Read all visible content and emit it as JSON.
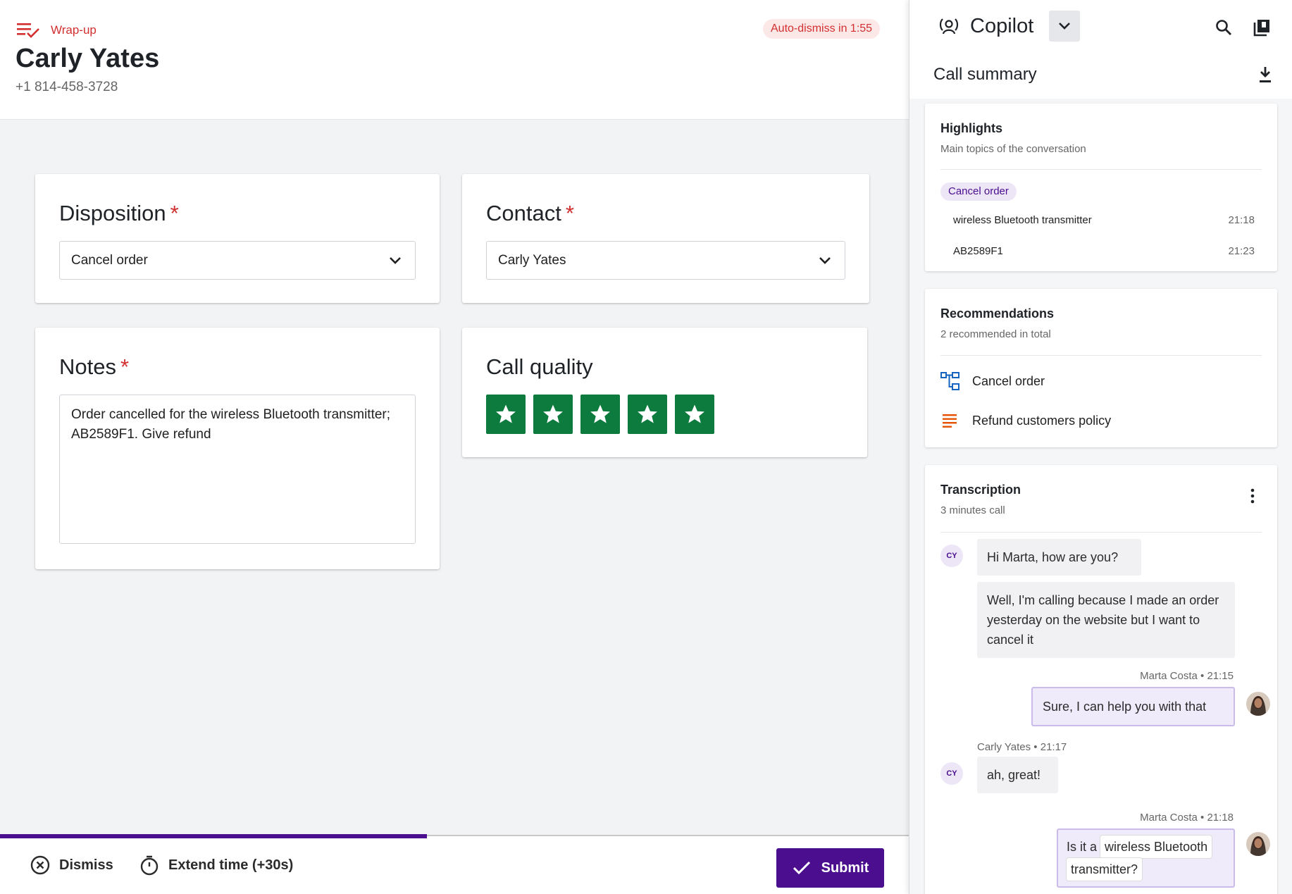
{
  "header": {
    "wrapup_label": "Wrap-up",
    "customer_name": "Carly Yates",
    "customer_phone": "+1 814-458-3728",
    "auto_dismiss": "Auto-dismiss in 1:55"
  },
  "form": {
    "disposition": {
      "label": "Disposition",
      "required": "*",
      "value": "Cancel order"
    },
    "contact": {
      "label": "Contact",
      "required": "*",
      "value": "Carly Yates"
    },
    "notes": {
      "label": "Notes",
      "required": "*",
      "value": "Order cancelled for the wireless Bluetooth transmitter; AB2589F1. Give refund"
    },
    "call_quality": {
      "label": "Call quality",
      "rating": 5,
      "max": 5
    }
  },
  "footer": {
    "dismiss_label": "Dismiss",
    "extend_label": "Extend time (+30s)",
    "submit_label": "Submit",
    "progress_fraction": 0.47
  },
  "copilot": {
    "title": "Copilot",
    "summary_title": "Call summary",
    "highlights": {
      "title": "Highlights",
      "subtitle": "Main topics of the conversation",
      "chip": "Cancel order",
      "items": [
        {
          "text": "wireless Bluetooth transmitter",
          "time": "21:18"
        },
        {
          "text": "AB2589F1",
          "time": "21:23"
        }
      ]
    },
    "recommendations": {
      "title": "Recommendations",
      "subtitle": "2 recommended in total",
      "items": [
        {
          "label": "Cancel order",
          "icon": "flow-icon"
        },
        {
          "label": "Refund customers policy",
          "icon": "document-lines-icon"
        }
      ]
    },
    "transcription": {
      "title": "Transcription",
      "subtitle": "3 minutes call",
      "customer_initials": "CY",
      "messages": [
        {
          "text": "Hi Marta, how are you?"
        },
        {
          "text": "Well, I'm calling because I made an order yesterday on the website but I want to cancel it"
        },
        {
          "meta": "Marta Costa • 21:15",
          "text": "Sure, I can help you with that"
        },
        {
          "meta": "Carly Yates • 21:17",
          "text": "ah, great!"
        },
        {
          "meta": "Marta Costa • 21:18",
          "text_prefix": "Is it a",
          "highlight_1": "wireless Bluetooth",
          "highlight_2": "transmitter?"
        }
      ]
    }
  },
  "colors": {
    "accent": "#4a0e8f",
    "danger": "#d32f2f",
    "star_green": "#0d7a3e",
    "chip_bg": "#ece6f7"
  }
}
